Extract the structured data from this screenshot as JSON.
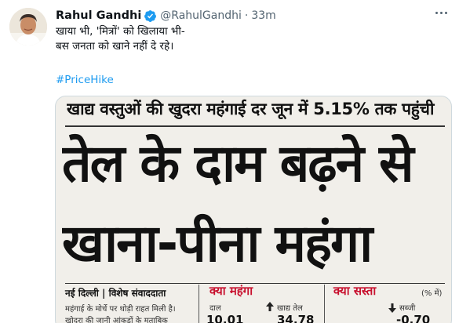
{
  "tweet": {
    "author_name": "Rahul Gandhi",
    "handle": "@RahulGandhi",
    "separator": "·",
    "timestamp": "33m",
    "lines": [
      "खाया भी, 'मित्रों' को खिलाया भी-",
      "बस जनता को खाने नहीं दे रहे।"
    ],
    "hashtag": "#PriceHike"
  },
  "clipping": {
    "headline_top": "खाद्य वस्तुओं की खुदरा महंगाई दर जून में 5.15% तक पहुंची",
    "headline_line1": "तेल के दाम बढ़ने से",
    "headline_line2": "खाना-पीना महंगा",
    "dateline": "नई दिल्ली | विशेष संवाददाता",
    "body_line1": "महंगाई के मोर्चे पर थोड़ी राहत मिली है।",
    "body_line2": "खोदरा की जानी आंकड़ों के मुताबिक",
    "costly_heading": "क्या महंगा",
    "costly_item1_label": "दाल",
    "costly_item1_value": "10.01",
    "costly_item2_label": "खाद्य तेल",
    "costly_item2_value": "34.78",
    "cheap_heading": "क्या सस्ता",
    "percent_note": "(% में)",
    "cheap_item1_label": "सब्जी",
    "cheap_item1_value": "-0.70"
  },
  "colors": {
    "accent": "#1d9bf0",
    "verified": "#1d9bf0",
    "text": "#0f1419",
    "muted": "#536471",
    "red_heading": "#c8102e"
  }
}
